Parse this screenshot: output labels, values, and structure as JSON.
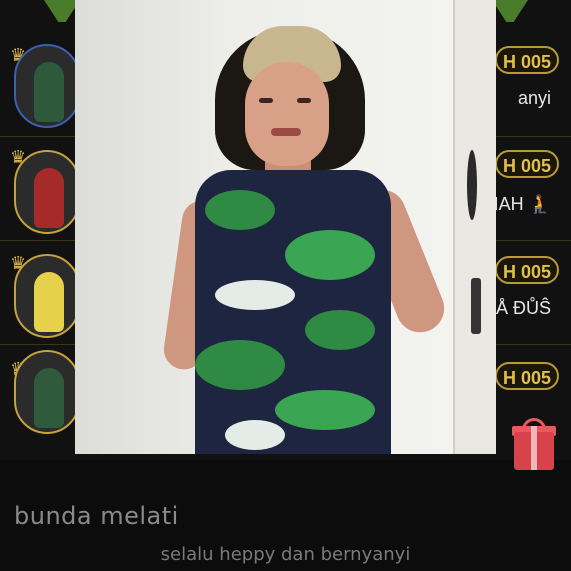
{
  "profile": {
    "name": "bunda melati",
    "status": "selalu heppy dan bernyanyi"
  },
  "list": {
    "rows": [
      {
        "badge": "H 005",
        "text": "anyi"
      },
      {
        "badge": "H 005",
        "text": "IAH 🧎"
      },
      {
        "badge": "H 005",
        "text": "Å ĐŮŜ"
      },
      {
        "badge": "H 005",
        "text": ""
      }
    ]
  },
  "icons": {
    "crown": "crown-icon",
    "gift": "gift-icon"
  },
  "colors": {
    "accent_gold": "#c3a23a",
    "badge_text": "#e2c04e",
    "tab_green": "#4a7d2a",
    "gift_red": "#d8424a"
  }
}
